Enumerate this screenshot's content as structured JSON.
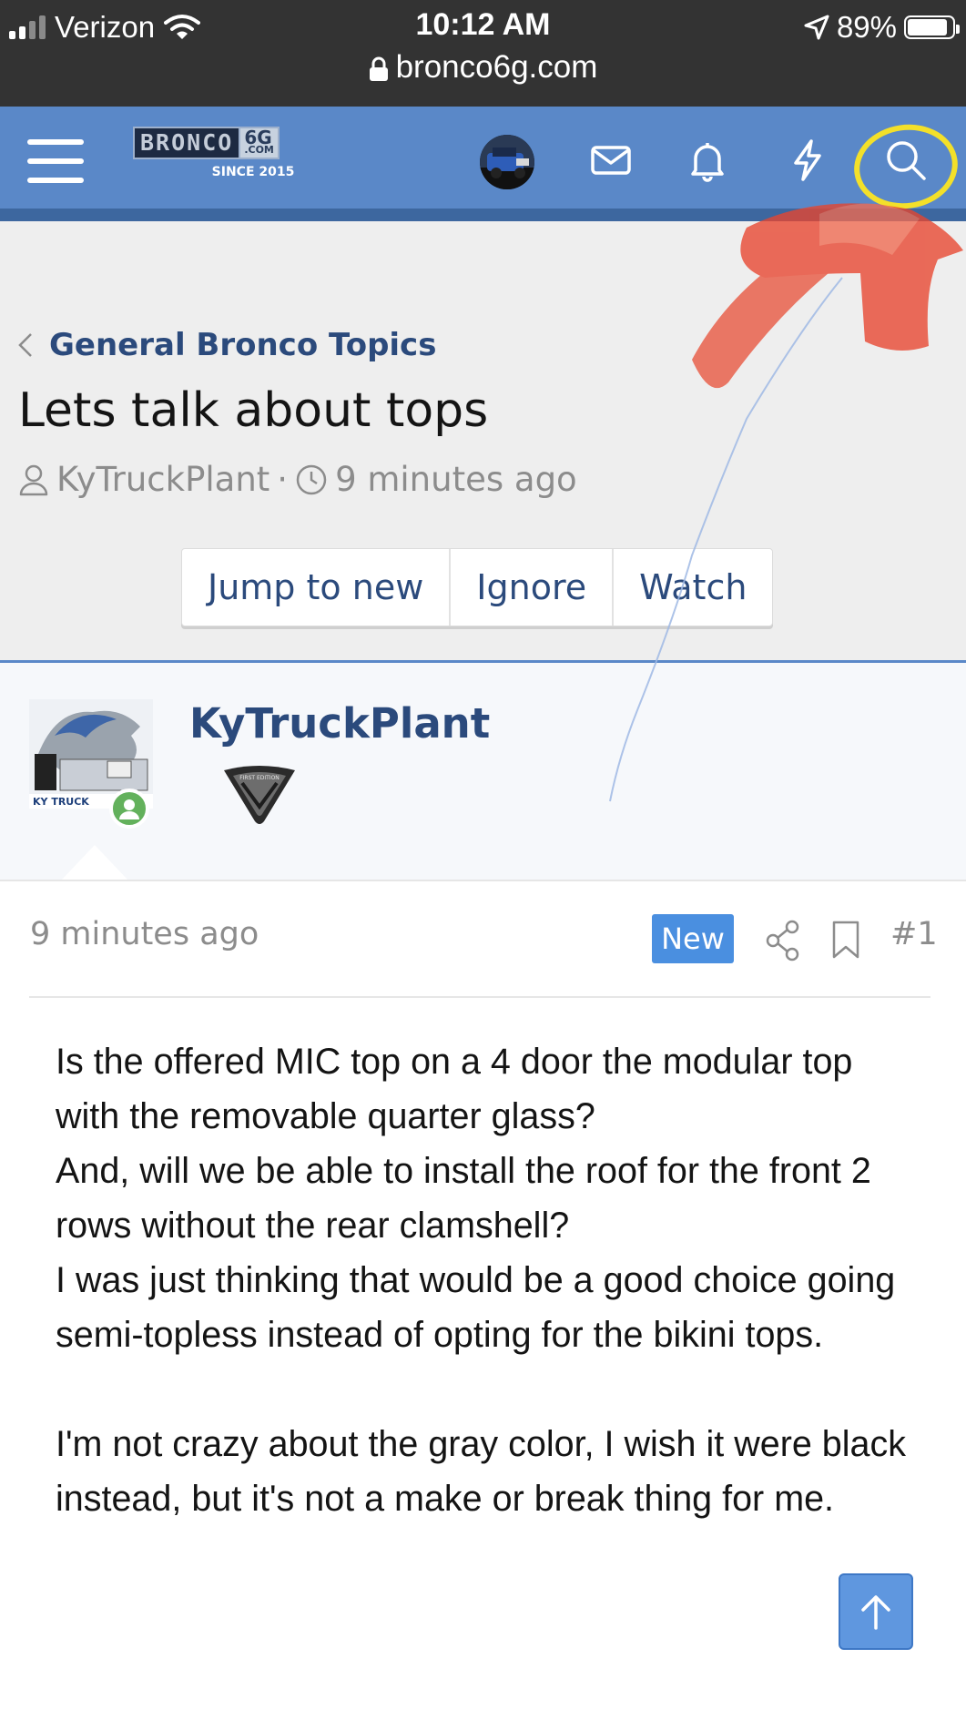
{
  "status_bar": {
    "carrier": "Verizon",
    "time": "10:12 AM",
    "battery_percent": "89%",
    "battery_level": 0.89,
    "url": "bronco6g.com"
  },
  "site_header": {
    "logo_word": "BRONCO",
    "logo_suffix": "6G",
    "logo_suffix_small": ".COM",
    "logo_tagline": "SINCE 2015",
    "icons": [
      "menu-icon",
      "avatar",
      "envelope-icon",
      "bell-icon",
      "bolt-icon",
      "search-icon"
    ]
  },
  "thread": {
    "breadcrumb": "General Bronco Topics",
    "title": "Lets talk about tops",
    "author": "KyTruckPlant",
    "separator": "·",
    "age": "9 minutes ago",
    "buttons": [
      "Jump to new",
      "Ignore",
      "Watch"
    ]
  },
  "user": {
    "name": "KyTruckPlant",
    "avatar_caption": "KY TRUCK",
    "badge_text": "FIRST EDITION"
  },
  "post": {
    "time": "9 minutes ago",
    "new_badge": "New",
    "number": "#1",
    "paragraph1": "Is the offered MIC top on a 4 door the modular top with the removable quarter glass?\nAnd, will we be able to install the roof for the front 2 rows without the rear clamshell?\nI was just thinking that would be a good choice going semi-topless instead of opting for the bikini tops.",
    "paragraph2": "I'm not crazy about the gray color, I wish it were black instead, but it's not a make or break thing for me."
  },
  "colors": {
    "header_blue": "#5a88c8",
    "link_blue": "#2b4a7c",
    "new_badge": "#4a8fe0",
    "highlight_yellow": "#f3e02a",
    "arrow_red": "#e8553e",
    "online_green": "#63b15c"
  }
}
